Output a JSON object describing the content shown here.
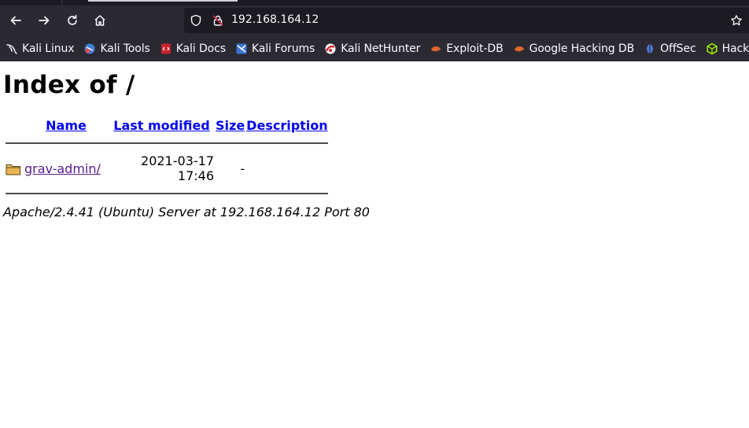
{
  "browser": {
    "url": "192.168.164.12",
    "bookmarks": [
      {
        "label": "Kali Linux",
        "icon": "kali-dragon-icon"
      },
      {
        "label": "Kali Tools",
        "icon": "kali-tools-icon"
      },
      {
        "label": "Kali Docs",
        "icon": "kali-docs-icon"
      },
      {
        "label": "Kali Forums",
        "icon": "kali-forums-icon"
      },
      {
        "label": "Kali NetHunter",
        "icon": "nethunter-icon"
      },
      {
        "label": "Exploit-DB",
        "icon": "exploit-db-icon"
      },
      {
        "label": "Google Hacking DB",
        "icon": "ghdb-icon"
      },
      {
        "label": "OffSec",
        "icon": "offsec-icon"
      },
      {
        "label": "Hack The B",
        "icon": "hackthebox-icon"
      }
    ]
  },
  "page": {
    "title": "Index of /",
    "columns": {
      "name": "Name",
      "last_modified": "Last modified",
      "size": "Size",
      "description": "Description"
    },
    "rows": [
      {
        "name": "grav-admin/",
        "last_modified": "2021-03-17 17:46",
        "size": "-",
        "description": "",
        "icon": "folder-icon"
      }
    ],
    "address": "Apache/2.4.41 (Ubuntu) Server at 192.168.164.12 Port 80"
  },
  "colors": {
    "chrome_dark": "#1c1b22",
    "toolbar": "#2b2a33",
    "link": "#0000ee",
    "visited": "#551a8b"
  }
}
